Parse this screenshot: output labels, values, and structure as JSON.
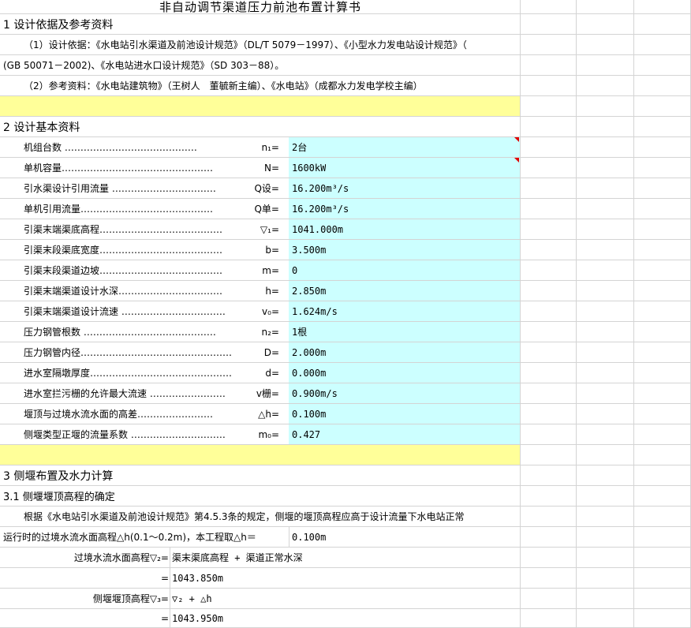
{
  "title": "非自动调节渠道压力前池布置计算书",
  "section1": {
    "heading": "1 设计依据及参考资料",
    "p1": "（1）设计依据：《水电站引水渠道及前池设计规范》（DL/T 5079－1997）、《小型水力发电站设计规范》（",
    "p2": "(GB 50071－2002)、《水电站进水口设计规范》（SD 303－88）。",
    "p3": "（2）参考资料：《水电站建筑物》（王树人　董毓新主编）、《水电站》（成都水力发电学校主编）"
  },
  "section2": {
    "heading": "2 设计基本资料",
    "params": [
      {
        "label": "机组台数 ……………………………………",
        "sym": "n₁=",
        "value": "2台"
      },
      {
        "label": "单机容量…………………………………………",
        "sym": "N=",
        "value": "1600kW"
      },
      {
        "label": "引水渠设计引用流量 ……………………………",
        "sym": "Q设=",
        "value": "16.200m³/s"
      },
      {
        "label": "单机引用流量……………………………………",
        "sym": "Q单=",
        "value": "16.200m³/s"
      },
      {
        "label": "引渠末端渠底高程…………………………………",
        "sym": "▽₁=",
        "value": "1041.000m"
      },
      {
        "label": "引渠末段渠底宽度…………………………………",
        "sym": "b=",
        "value": "3.500m"
      },
      {
        "label": "引渠末段渠道边坡…………………………………",
        "sym": "m=",
        "value": "0"
      },
      {
        "label": "引渠末端渠道设计水深……………………………",
        "sym": "h=",
        "value": "2.850m"
      },
      {
        "label": "引渠末端渠道设计流速 ……………………………",
        "sym": "v₀=",
        "value": "1.624m/s"
      },
      {
        "label": "压力钢管根数 ……………………………………",
        "sym": "n₂=",
        "value": "1根"
      },
      {
        "label": "压力钢管内径…………………………………………",
        "sym": "D=",
        "value": "2.000m"
      },
      {
        "label": "进水室隔墩厚度………………………………………",
        "sym": "d=",
        "value": "0.000m"
      },
      {
        "label": "进水室拦污栅的允许最大流速 ……………………",
        "sym": "v栅=",
        "value": "0.900m/s"
      },
      {
        "label": "堰顶与过境水流水面的高差……………………",
        "sym": "△h=",
        "value": "0.100m"
      },
      {
        "label": "侧堰类型正堰的流量系数 …………………………",
        "sym": "m₀=",
        "value": "0.427"
      }
    ]
  },
  "section3": {
    "heading": "3 侧堰布置及水力计算",
    "sub1": "3.1 侧堰堰顶高程的确定",
    "p1": "根据《水电站引水渠道及前池设计规范》第4.5.3条的规定，侧堰的堰顶高程应高于设计流量下水电站正常",
    "p2": "运行时的过境水流水面高程△h(0.1～0.2m)，本工程取△h＝",
    "p2_value": "0.100m",
    "f1_label": "过境水流水面高程▽₂=",
    "f1_expr": "渠末渠底高程 + 渠道正常水深",
    "f1_eq": "=",
    "f1_result": "1043.850m",
    "f2_label": "侧堰堰顶高程▽₃=",
    "f2_expr": "▽₂ + △h",
    "f2_eq": "=",
    "f2_result": "1043.950m"
  }
}
